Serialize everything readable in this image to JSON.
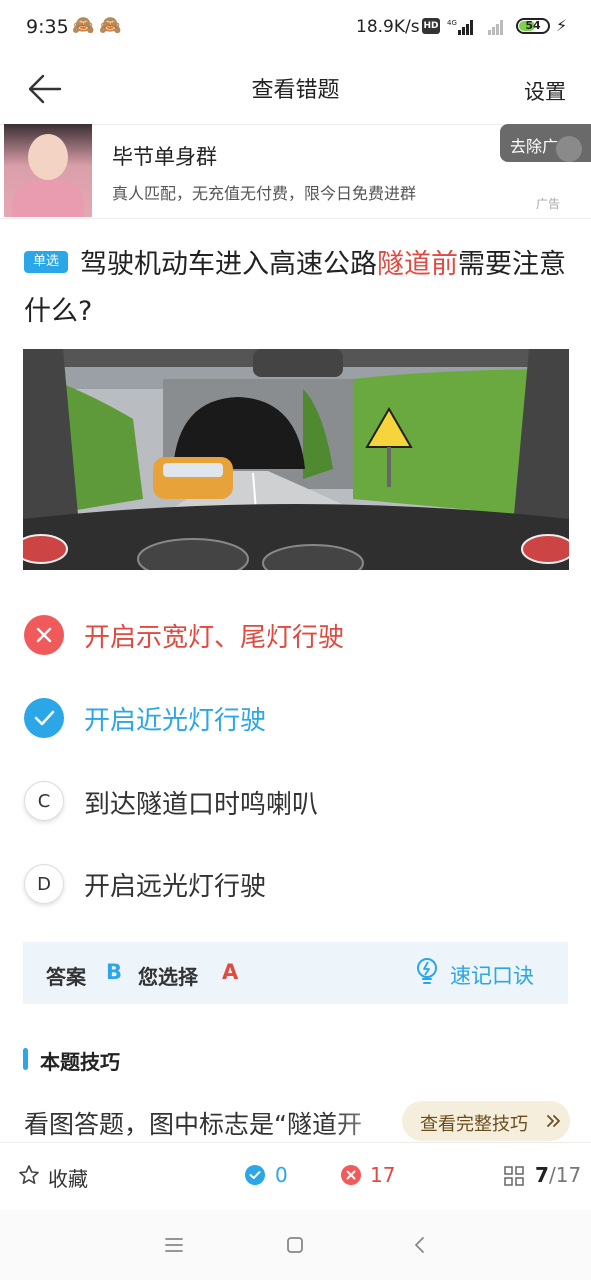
{
  "status": {
    "time": "9:35",
    "net_speed": "18.9K/s",
    "hd": "HD",
    "network_type": "4G",
    "battery": "54"
  },
  "nav": {
    "title": "查看错题",
    "settings": "设置"
  },
  "ad": {
    "title": "毕节单身群",
    "subtitle": "真人匹配，无充值无付费，限今日免费进群",
    "close_label": "去除广告",
    "tag": "广告"
  },
  "question": {
    "type_badge": "单选",
    "text_before": "驾驶机动车进入高速公路",
    "text_highlight": "隧道前",
    "text_after": "需要注意什么?"
  },
  "options": [
    {
      "marker": "",
      "text": "开启示宽灯、尾灯行驶",
      "state": "wrong"
    },
    {
      "marker": "",
      "text": "开启近光灯行驶",
      "state": "correct"
    },
    {
      "marker": "C",
      "text": "到达隧道口时鸣喇叭",
      "state": "normal"
    },
    {
      "marker": "D",
      "text": "开启远光灯行驶",
      "state": "normal"
    }
  ],
  "answer": {
    "label": "答案",
    "correct": "B",
    "yours_label": "您选择",
    "yours": "A",
    "memo_label": "速记口诀"
  },
  "tips": {
    "title": "本题技巧",
    "text": "看图答题，图中标志是“隧道开",
    "button": "查看完整技巧"
  },
  "toolbar": {
    "favorite": "收藏",
    "correct_count": "0",
    "wrong_count": "17",
    "current": "7",
    "total": "/17"
  },
  "colors": {
    "accent": "#2ba6e6",
    "error": "#e04a3f",
    "wrong_option_bg": "#f05a5a"
  },
  "icons": [
    "back-arrow-icon",
    "close-icon",
    "check-icon",
    "bulb-icon",
    "double-chevron-right-icon",
    "star-icon",
    "grid-icon",
    "menu-icon",
    "home-square-icon",
    "back-chevron-icon"
  ]
}
